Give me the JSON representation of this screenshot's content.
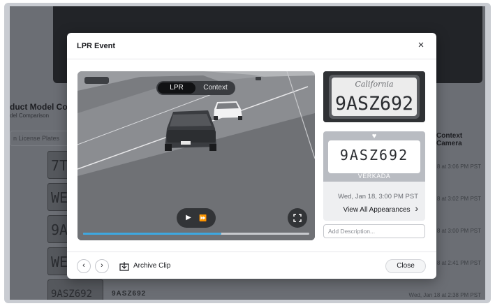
{
  "background": {
    "title": "duct Model Com",
    "subtitle": "del Comparison",
    "search_placeholder": "n License Plates",
    "column_header": "Context Camera",
    "plates": [
      "7TI",
      "WE",
      "9AS",
      "WE",
      "9ASZ692"
    ],
    "times": [
      "8 at 3:06 PM PST",
      "8 at 3:02 PM PST",
      "8 at 3:00 PM PST",
      "8 at 2:41 PM PST",
      "Wed, Jan 18 at 2:38 PM PST"
    ],
    "row_plate": "9ASZ692"
  },
  "modal": {
    "title": "LPR Event",
    "close_icon": "×",
    "toggle": {
      "lpr": "LPR",
      "context": "Context",
      "selected": "LPR"
    },
    "playback": {
      "progress": 0.61,
      "play_icon": "▶",
      "fast_forward_icon": "⏩"
    },
    "plate_photo": {
      "state_script": "California",
      "number": "9ASZ692"
    },
    "plate_card": {
      "number": "9ASZ692",
      "brand": "VERKADA",
      "heart_icon": "♥",
      "timestamp": "Wed, Jan 18, 3:00 PM PST",
      "view_all_label": "View All Appearances",
      "chevron": "›"
    },
    "description": {
      "placeholder": "Add Description...",
      "value": ""
    },
    "footer": {
      "prev_icon": "‹",
      "next_icon": "›",
      "archive_label": "Archive Clip",
      "close_label": "Close"
    }
  },
  "colors": {
    "accent": "#3ea8e0",
    "brand_band": "#b9bcc2"
  }
}
